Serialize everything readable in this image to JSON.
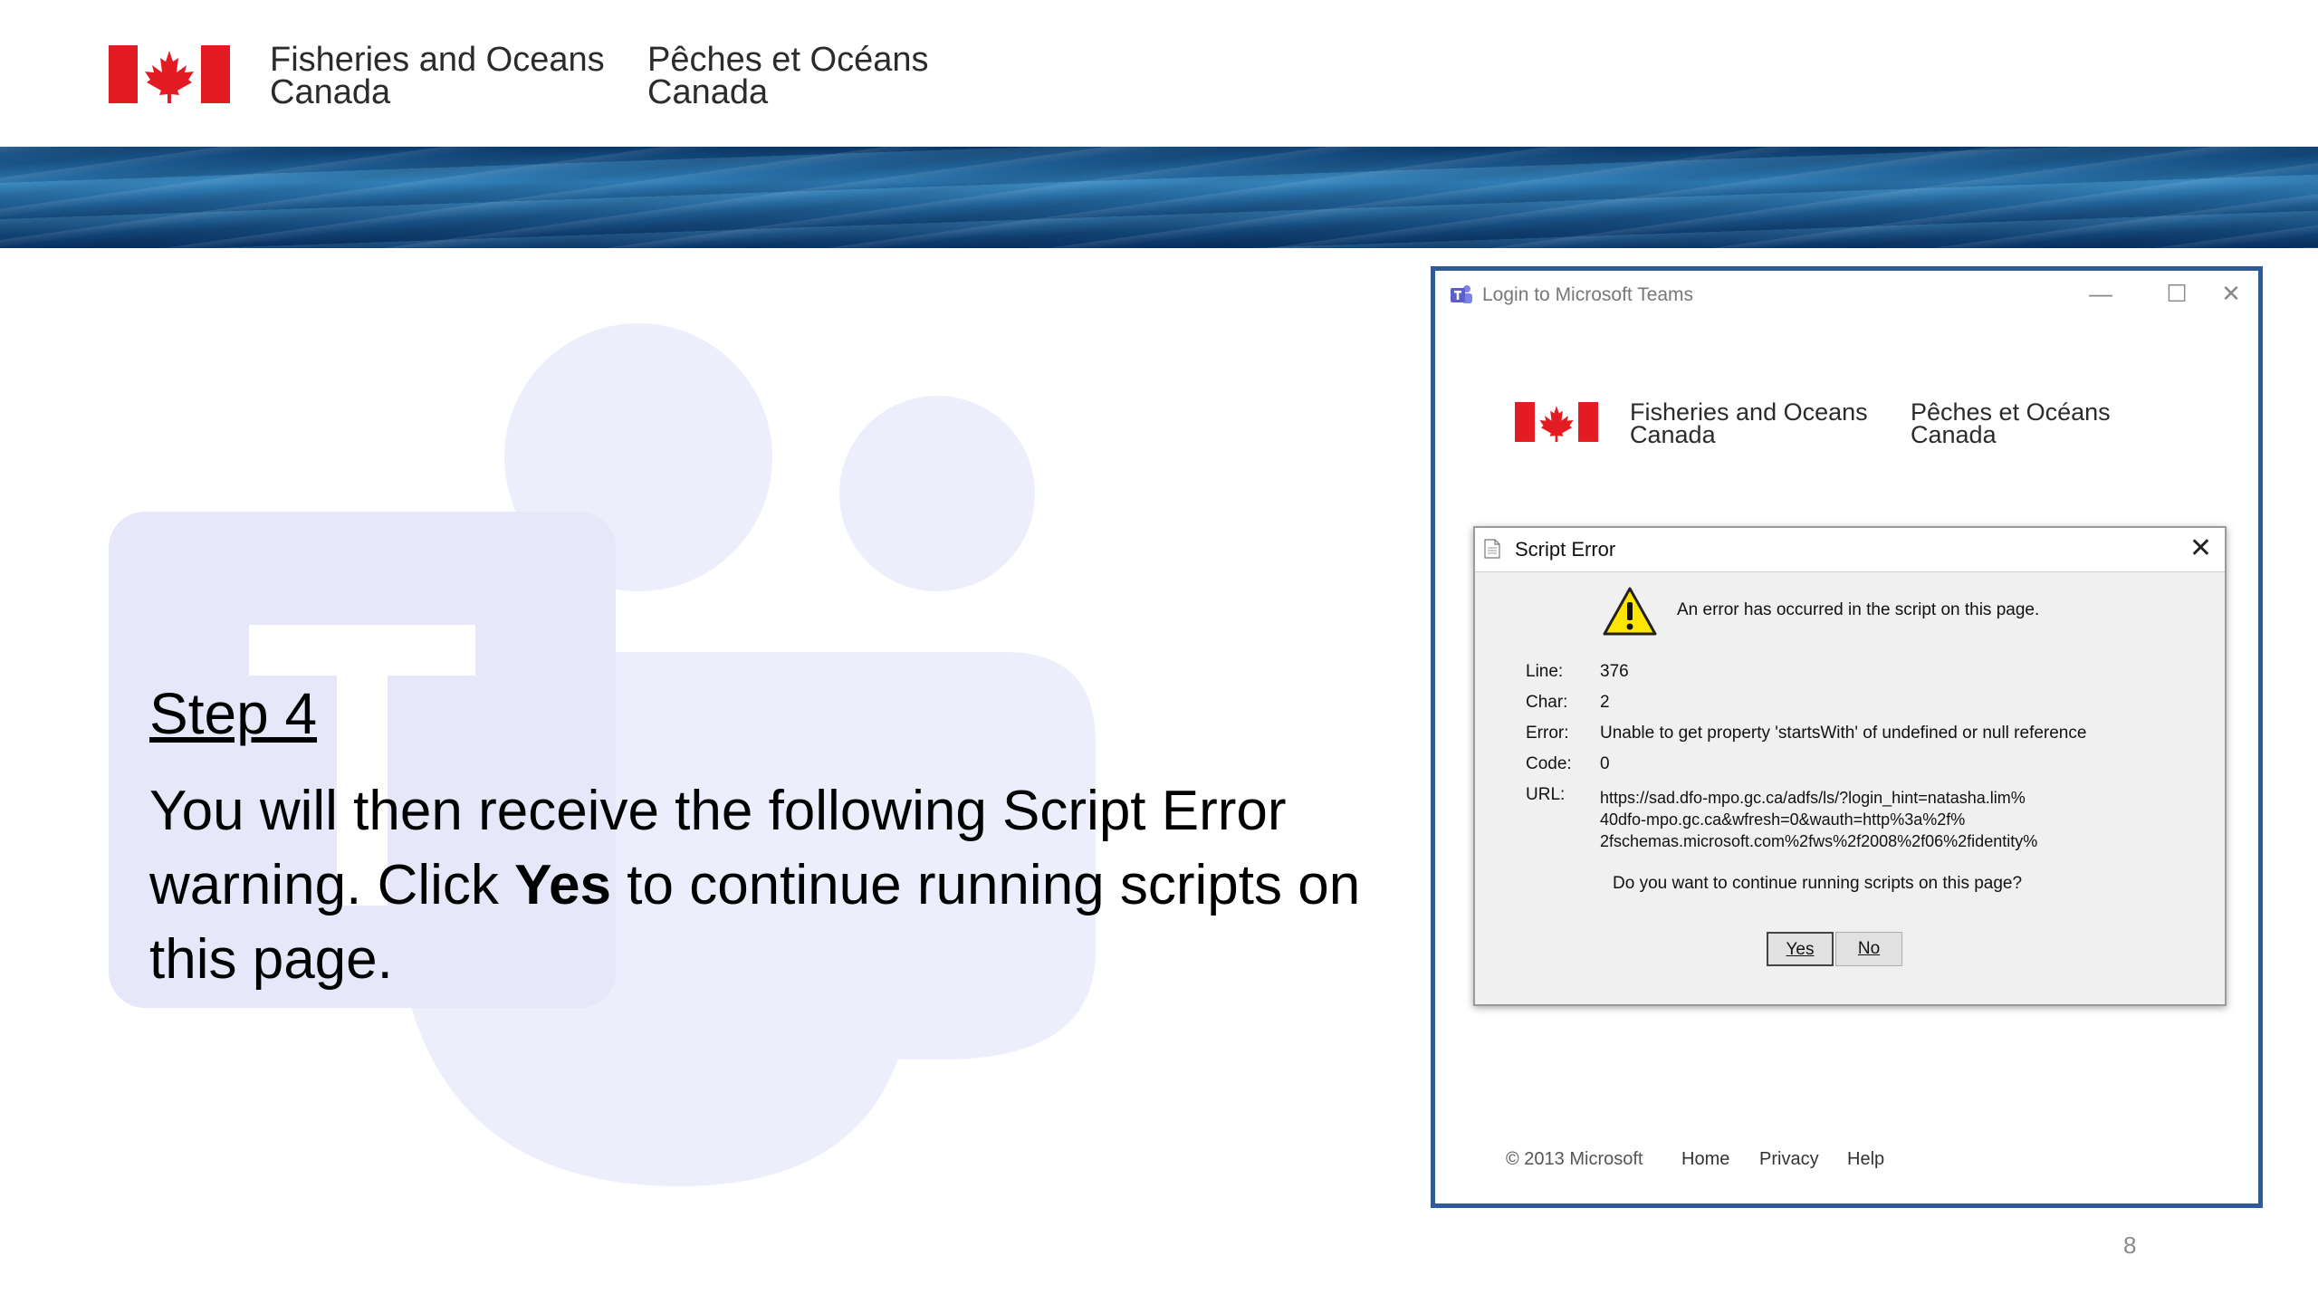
{
  "header": {
    "org_en_line1": "Fisheries and Oceans",
    "org_en_line2": "Canada",
    "org_fr_line1": "Pêches et Océans",
    "org_fr_line2": "Canada"
  },
  "step": {
    "title": "Step 4",
    "body_part1": "You will then receive the following Script Error warning. Click ",
    "body_bold": "Yes",
    "body_part2": " to continue running scripts on this page."
  },
  "window": {
    "title": "Login to Microsoft Teams",
    "minimize": "—",
    "maximize": "☐",
    "close": "✕",
    "org_en_line1": "Fisheries and Oceans",
    "org_en_line2": "Canada",
    "org_fr_line1": "Pêches et Océans",
    "org_fr_line2": "Canada",
    "footer": {
      "copyright": "© 2013 Microsoft",
      "home": "Home",
      "privacy": "Privacy",
      "help": "Help"
    }
  },
  "dialog": {
    "title": "Script Error",
    "close": "✕",
    "message": "An error has occurred in the script on this page.",
    "fields": [
      {
        "label": "Line:",
        "value": "376"
      },
      {
        "label": "Char:",
        "value": "2"
      },
      {
        "label": "Error:",
        "value": "Unable to get property 'startsWith' of undefined or null reference"
      },
      {
        "label": "Code:",
        "value": "0"
      },
      {
        "label": "URL:",
        "value": ""
      }
    ],
    "url_lines": [
      "https://sad.dfo-mpo.gc.ca/adfs/ls/?login_hint=natasha.lim%",
      "40dfo-mpo.gc.ca&wfresh=0&wauth=http%3a%2f%",
      "2fschemas.microsoft.com%2fws%2f2008%2f06%2fidentity%"
    ],
    "question": "Do you want to continue running scripts on this page?",
    "yes_label": "Yes",
    "no_label": "No"
  },
  "page_number": "8",
  "colors": {
    "flag_red": "#e31b23",
    "window_border": "#2f5a96",
    "teams_purple": "#5b5fc7",
    "logo_tint": "#eceefb"
  }
}
